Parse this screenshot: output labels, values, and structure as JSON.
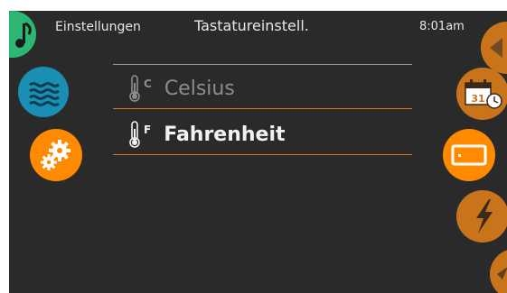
{
  "header": {
    "back_label": "Einstellungen",
    "title": "Tastatureinstell.",
    "time": "8:01am"
  },
  "options": [
    {
      "unit": "C",
      "label": "Celsius",
      "selected": false
    },
    {
      "unit": "F",
      "label": "Fahrenheit",
      "selected": true
    }
  ],
  "left_nav": [
    {
      "icon": "music-note-icon",
      "color": "#2bb673"
    },
    {
      "icon": "water-waves-icon",
      "color": "#1b8fb3"
    },
    {
      "icon": "gears-icon",
      "color": "#ff8a00"
    }
  ],
  "right_nav": [
    {
      "icon": "partial-orange-icon",
      "color": "#c9741b"
    },
    {
      "icon": "calendar-clock-icon",
      "color": "#c9741b",
      "calendar_day": "31"
    },
    {
      "icon": "display-screen-icon",
      "color": "#ff8a00"
    },
    {
      "icon": "lightning-icon",
      "color": "#c9741b"
    },
    {
      "icon": "partial-bottom-icon",
      "color": "#c9741b"
    }
  ],
  "colors": {
    "background": "#2a2a2a",
    "accent": "#ff8a00",
    "divider_top": "#9a9a9a",
    "divider_orange": "#d9731a"
  }
}
